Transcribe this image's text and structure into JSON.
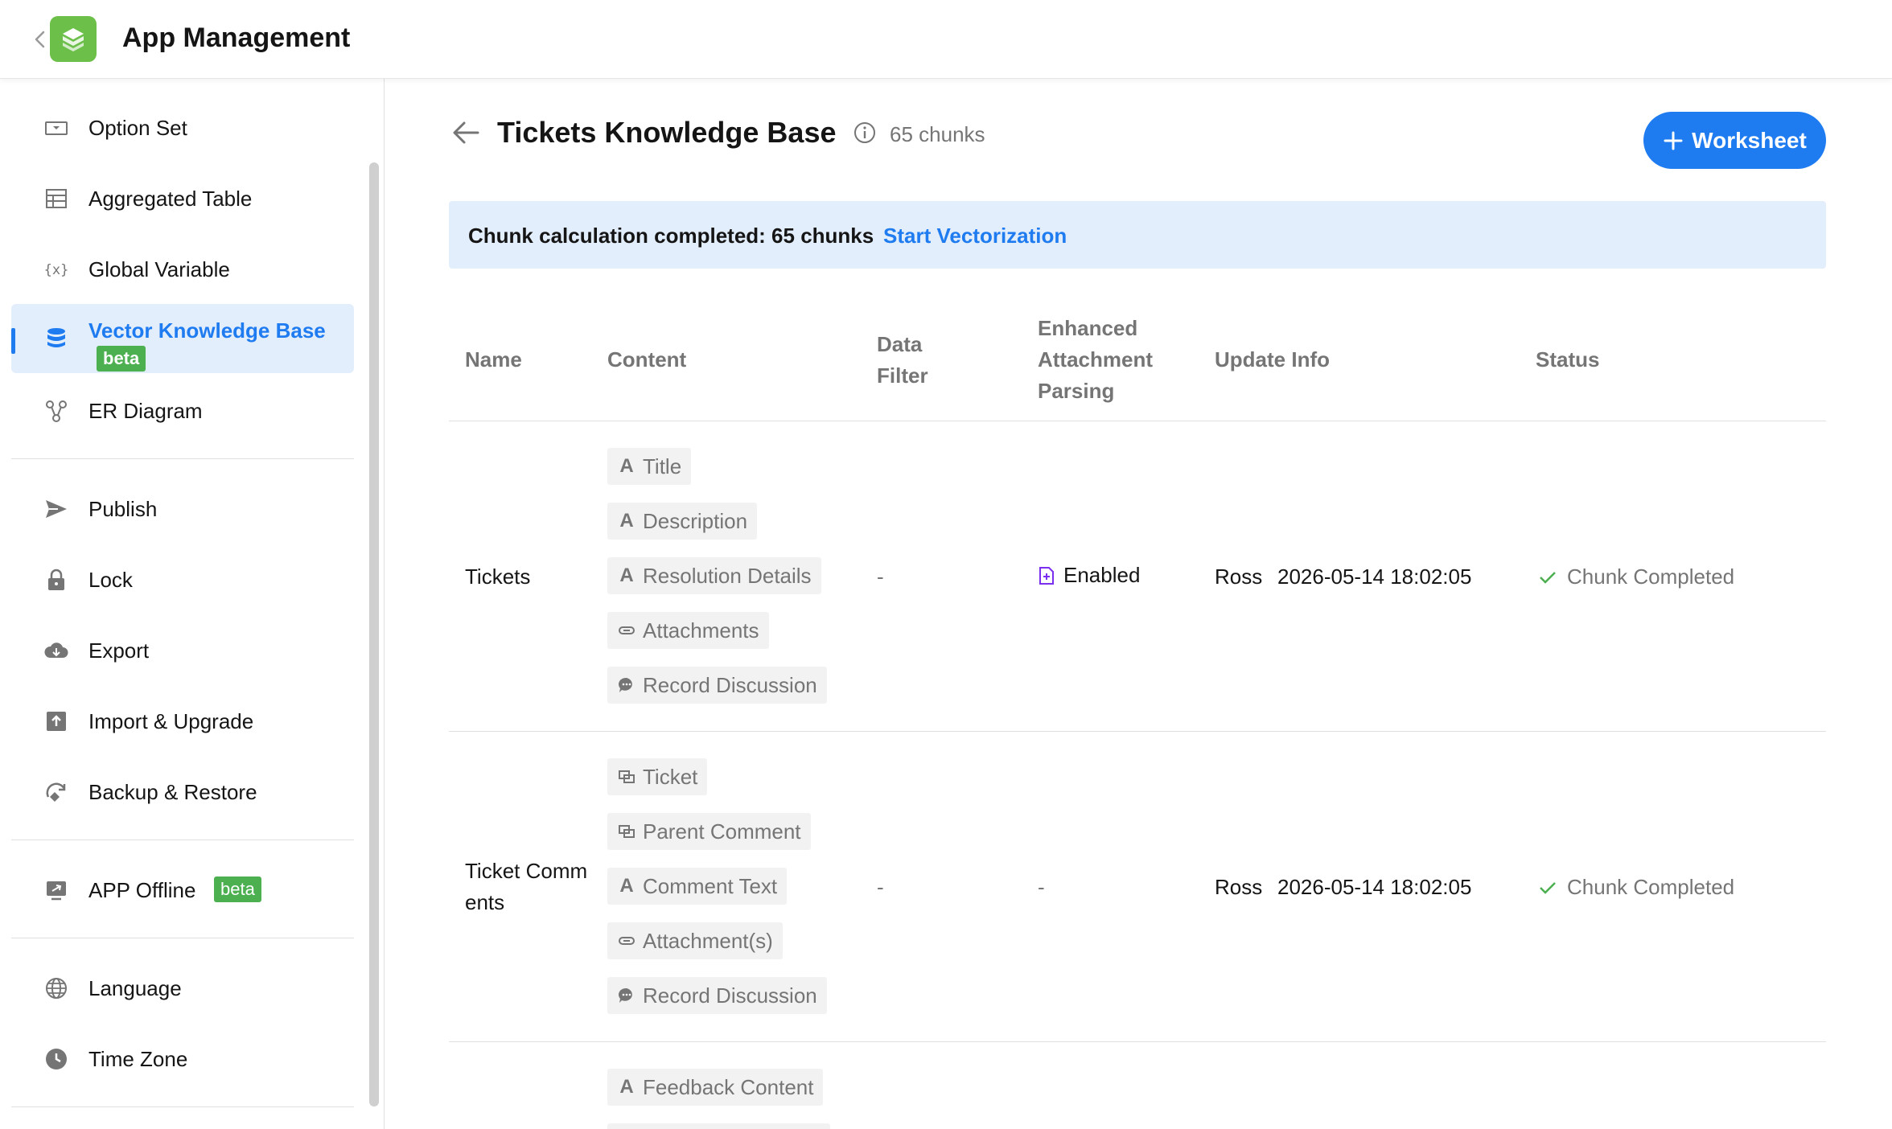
{
  "header": {
    "title": "App Management"
  },
  "sidebar": {
    "items": [
      {
        "label": "Option Set",
        "icon": "option-set-icon"
      },
      {
        "label": "Aggregated Table",
        "icon": "aggregated-table-icon"
      },
      {
        "label": "Global Variable",
        "icon": "global-variable-icon"
      },
      {
        "label": "Vector Knowledge Base",
        "icon": "database-icon",
        "badge": "beta",
        "active": true
      },
      {
        "label": "ER Diagram",
        "icon": "er-diagram-icon"
      },
      {
        "label": "Publish",
        "icon": "send-icon"
      },
      {
        "label": "Lock",
        "icon": "lock-icon"
      },
      {
        "label": "Export",
        "icon": "cloud-download-icon"
      },
      {
        "label": "Import & Upgrade",
        "icon": "import-icon"
      },
      {
        "label": "Backup & Restore",
        "icon": "backup-icon"
      },
      {
        "label": "APP Offline",
        "icon": "offline-icon",
        "badge": "beta"
      },
      {
        "label": "Language",
        "icon": "globe-icon"
      },
      {
        "label": "Time Zone",
        "icon": "clock-icon"
      }
    ]
  },
  "main": {
    "title": "Tickets Knowledge Base",
    "chunk_count": "65 chunks",
    "worksheet_button": "Worksheet",
    "banner": {
      "text": "Chunk calculation completed: 65 chunks",
      "link": "Start Vectorization"
    },
    "columns": [
      "Name",
      "Content",
      "Data Filter",
      "Enhanced Attachment Parsing",
      "Update Info",
      "Status"
    ],
    "rows": [
      {
        "name": "Tickets",
        "content": [
          {
            "label": "Title",
            "icon": "text-field-icon"
          },
          {
            "label": "Description",
            "icon": "text-field-icon"
          },
          {
            "label": "Resolution Details",
            "icon": "text-field-icon"
          },
          {
            "label": "Attachments",
            "icon": "attachment-icon"
          },
          {
            "label": "Record Discussion",
            "icon": "discussion-icon"
          }
        ],
        "data_filter": "-",
        "attachment_parsing": "Enabled",
        "update_user": "Ross",
        "update_time": "2026-05-14 18:02:05",
        "status": "Chunk Completed"
      },
      {
        "name": "Ticket Comm ents",
        "content": [
          {
            "label": "Ticket",
            "icon": "relation-icon"
          },
          {
            "label": "Parent Comment",
            "icon": "relation-icon"
          },
          {
            "label": "Comment Text",
            "icon": "text-field-icon"
          },
          {
            "label": "Attachment(s)",
            "icon": "attachment-icon"
          },
          {
            "label": "Record Discussion",
            "icon": "discussion-icon"
          }
        ],
        "data_filter": "-",
        "attachment_parsing": "-",
        "update_user": "Ross",
        "update_time": "2026-05-14 18:02:05",
        "status": "Chunk Completed"
      },
      {
        "content": [
          {
            "label": "Feedback Content",
            "icon": "text-field-icon"
          }
        ]
      }
    ]
  },
  "colors": {
    "accent": "#1e7bf0",
    "success": "#4caf50",
    "logo": "#6cc04a"
  }
}
